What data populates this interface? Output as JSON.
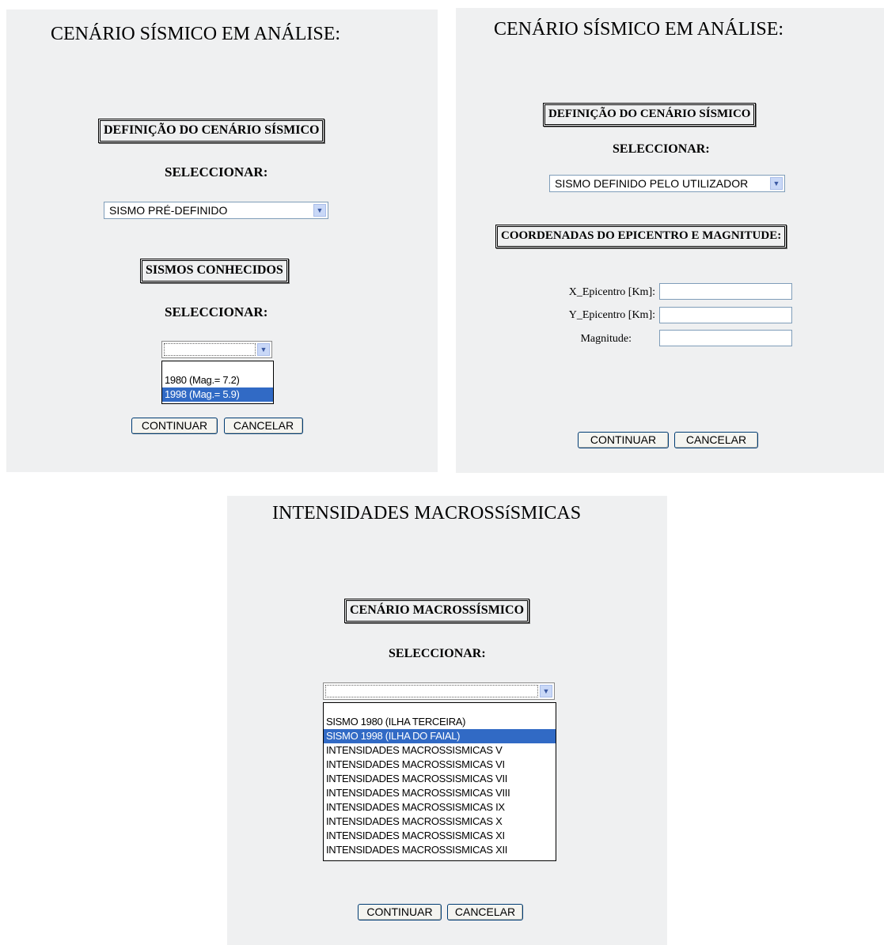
{
  "panel1": {
    "title": "CENÁRIO SÍSMICO EM ANÁLISE:",
    "definition_box": "DEFINIÇÃO DO CENÁRIO SÍSMICO",
    "select_label": "SELECCIONAR:",
    "scenario_select_value": "SISMO PRÉ-DEFINIDO",
    "known_box": "SISMOS CONHECIDOS",
    "select_label_2": "SELECCIONAR:",
    "known_select_value": "",
    "known_options": [
      "1980 (Mag.= 7.2)",
      "1998 (Mag.= 5.9)"
    ],
    "known_selected_index": 1,
    "continue_button": "CONTINUAR",
    "cancel_button": "CANCELAR"
  },
  "panel2": {
    "title": "CENÁRIO SÍSMICO EM ANÁLISE:",
    "definition_box": "DEFINIÇÃO DO CENÁRIO SÍSMICO",
    "select_label": "SELECCIONAR:",
    "scenario_select_value": "SISMO DEFINIDO PELO UTILIZADOR",
    "coords_box": "COORDENADAS DO EPICENTRO E MAGNITUDE:",
    "x_label": "X_Epicentro [Km]:",
    "y_label": "Y_Epicentro [Km]:",
    "magnitude_label": "Magnitude:",
    "x_value": "",
    "y_value": "",
    "magnitude_value": "",
    "continue_button": "CONTINUAR",
    "cancel_button": "CANCELAR"
  },
  "panel3": {
    "title": "INTENSIDADES MACROSSíSMICAS",
    "scenario_box": "CENÁRIO MACROSSÍSMICO",
    "select_label": "SELECCIONAR:",
    "select_value": "",
    "options": [
      "SISMO 1980 (ILHA TERCEIRA)",
      "SISMO 1998 (ILHA DO FAIAL)",
      "INTENSIDADES MACROSSISMICAS V",
      "INTENSIDADES MACROSSISMICAS VI",
      "INTENSIDADES MACROSSISMICAS VII",
      "INTENSIDADES MACROSSISMICAS VIII",
      "INTENSIDADES MACROSSISMICAS IX",
      "INTENSIDADES MACROSSISMICAS X",
      "INTENSIDADES MACROSSISMICAS XI",
      "INTENSIDADES MACROSSISMICAS XII"
    ],
    "selected_index": 1,
    "continue_button": "CONTINUAR",
    "cancel_button": "CANCELAR"
  },
  "colors": {
    "panel_background": "#eff0f1",
    "selection_highlight": "#316ac5"
  }
}
